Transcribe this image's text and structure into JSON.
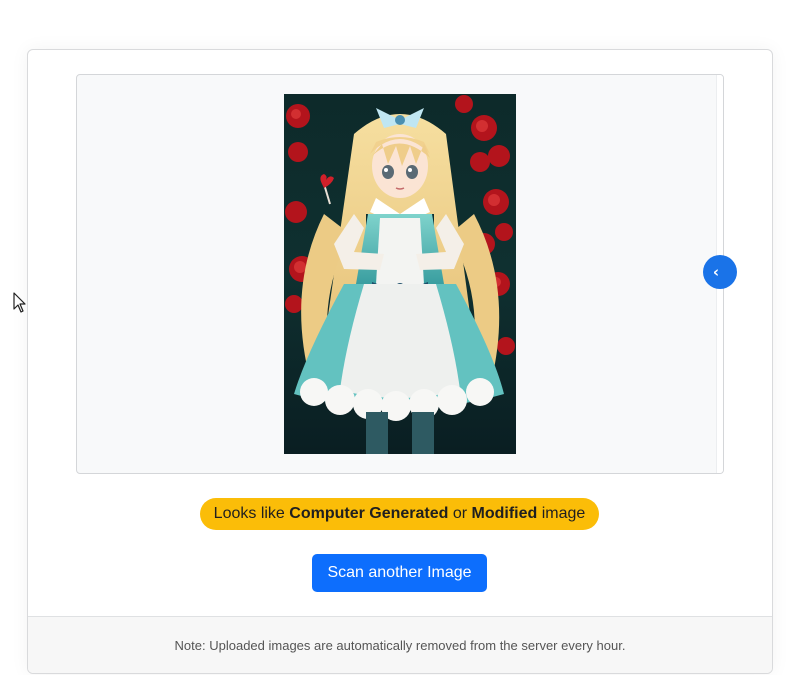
{
  "preview": {
    "image_description_icon": "uploaded-image",
    "toggle_icon": "chevron-left-icon",
    "toggle_glyph": "‹"
  },
  "result": {
    "prefix": "Looks like ",
    "strong1": "Computer Generated",
    "middle": " or ",
    "strong2": "Modified",
    "suffix": " image"
  },
  "actions": {
    "scan_label": "Scan another Image"
  },
  "footer": {
    "note": "Note: Uploaded images are automatically removed from the server every hour."
  },
  "colors": {
    "badge": "#fbbd08",
    "primary": "#0d6efd",
    "toggle": "#1a73e8"
  }
}
